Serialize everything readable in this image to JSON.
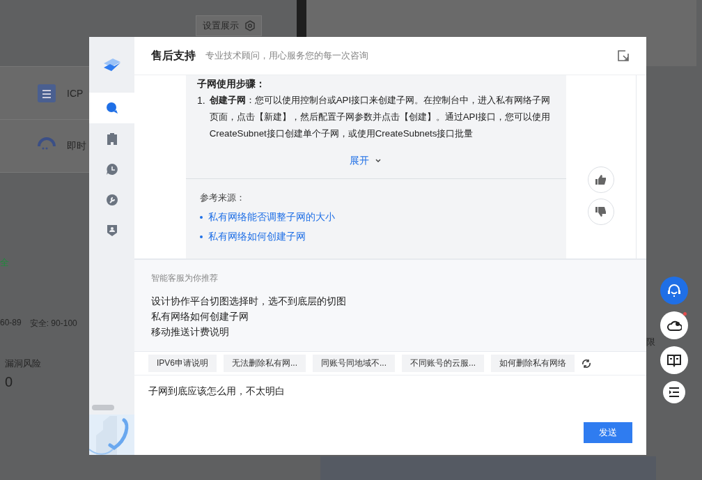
{
  "background": {
    "settings_button": "设置展示",
    "tiles": [
      {
        "label": "ICP",
        "kind": "doc"
      },
      {
        "label": "即时",
        "kind": "chat"
      }
    ],
    "status_text": "全",
    "score_ranges": [
      "60-89",
      "安全: 90-100"
    ],
    "metrics": [
      {
        "label": "漏洞风险",
        "value": "0"
      }
    ],
    "side_text": "限"
  },
  "dialog": {
    "title": "售后支持",
    "subtitle": "专业技术顾问，用心服务您的每一次咨询",
    "nav": [
      {
        "kind": "chat",
        "selected": true
      },
      {
        "kind": "clipboard",
        "selected": false
      },
      {
        "kind": "clock",
        "selected": false
      },
      {
        "kind": "wrench",
        "selected": false
      },
      {
        "kind": "shield",
        "selected": false
      }
    ],
    "message": {
      "heading": "子网使用步骤：",
      "steps": [
        {
          "number": "1.",
          "text": "**创建子网**：您可以使用控制台或API接口来创建子网。在控制台中，进入私有网络子网页面，点击【新建】，然后配置子网参数并点击【创建】。通过API接口，您可以使用CreateSubnet接口创建单个子网，或使用CreateSubnets接口批量"
        }
      ],
      "expand": "展开",
      "sources_label": "参考来源：",
      "sources": [
        "私有网络能否调整子网的大小",
        "私有网络如何创建子网"
      ]
    },
    "recommend": {
      "title": "智能客服为你推荐",
      "items": [
        "设计协作平台切图选择时，选不到底层的切图",
        "私有网络如何创建子网",
        "移动推送计费说明"
      ]
    },
    "chips": [
      "IPV6申请说明",
      "无法删除私有网...",
      "同账号同地域不...",
      "不同账号的云服...",
      "如何删除私有网络"
    ],
    "input": {
      "value": "子网到底应该怎么用，不太明白"
    },
    "send": "发送"
  },
  "floating": [
    {
      "kind": "support",
      "selected": true,
      "badge": false
    },
    {
      "kind": "cloud",
      "selected": false,
      "badge": true
    },
    {
      "kind": "book",
      "selected": false,
      "badge": false
    },
    {
      "kind": "list",
      "selected": false,
      "badge": false
    }
  ]
}
